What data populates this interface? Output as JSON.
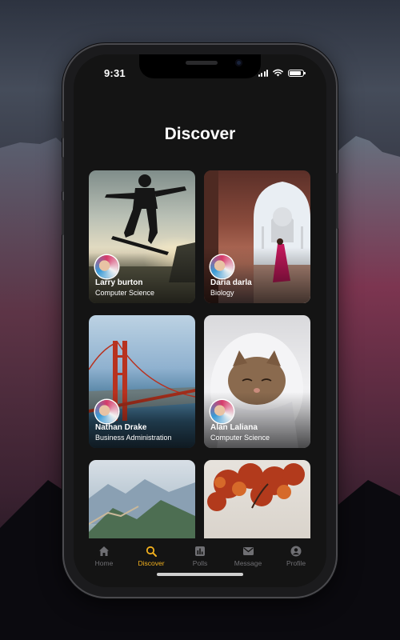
{
  "status_bar": {
    "time": "9:31"
  },
  "page": {
    "title": "Discover"
  },
  "cards": [
    {
      "name": "Larry burton",
      "subtitle": "Computer Science"
    },
    {
      "name": "Daria darla",
      "subtitle": "Biology"
    },
    {
      "name": "Nathan Drake",
      "subtitle": "Business Administration"
    },
    {
      "name": "Alan Laliana",
      "subtitle": "Computer Science"
    },
    {
      "name": "",
      "subtitle": ""
    },
    {
      "name": "",
      "subtitle": ""
    }
  ],
  "tabs": [
    {
      "label": "Home",
      "icon": "home-icon"
    },
    {
      "label": "Discover",
      "icon": "search-icon",
      "active": true
    },
    {
      "label": "Polls",
      "icon": "bar-chart-icon"
    },
    {
      "label": "Message",
      "icon": "mail-icon"
    },
    {
      "label": "Profile",
      "icon": "user-circle-icon"
    }
  ],
  "colors": {
    "accent": "#f2b01e",
    "tab_inactive": "#6f6f73",
    "screen_bg": "#141414"
  }
}
